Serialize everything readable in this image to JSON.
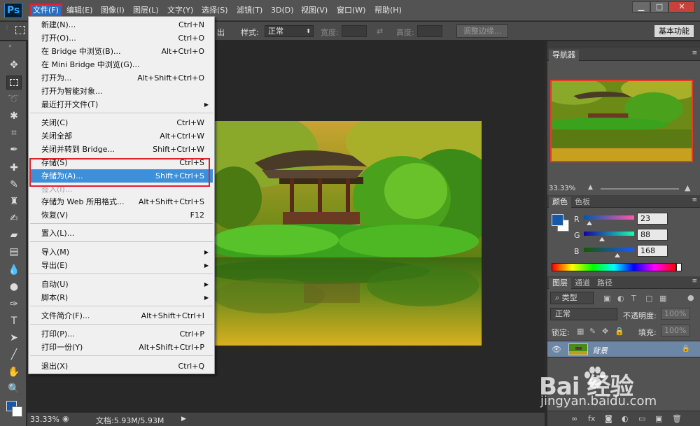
{
  "app": {
    "logo": "Ps"
  },
  "menubar": {
    "items": [
      "文件(F)",
      "编辑(E)",
      "图像(I)",
      "图层(L)",
      "文字(Y)",
      "选择(S)",
      "滤镜(T)",
      "3D(D)",
      "视图(V)",
      "窗口(W)",
      "帮助(H)"
    ],
    "active_index": 0
  },
  "window_controls": {
    "minimize": "▁",
    "maximize": "□",
    "close": "✕"
  },
  "options_bar": {
    "feather_tail": "出",
    "style_label": "样式:",
    "style_value": "正常",
    "width_label": "宽度:",
    "height_label": "高度:",
    "refine_edge_label": "调整边缘...",
    "workspace_label": "基本功能"
  },
  "file_menu": {
    "items": [
      {
        "label": "新建(N)...",
        "shortcut": "Ctrl+N"
      },
      {
        "label": "打开(O)...",
        "shortcut": "Ctrl+O"
      },
      {
        "label": "在 Bridge 中浏览(B)...",
        "shortcut": "Alt+Ctrl+O"
      },
      {
        "label": "在 Mini Bridge 中浏览(G)...",
        "shortcut": ""
      },
      {
        "label": "打开为...",
        "shortcut": "Alt+Shift+Ctrl+O"
      },
      {
        "label": "打开为智能对象...",
        "shortcut": ""
      },
      {
        "label": "最近打开文件(T)",
        "shortcut": "",
        "submenu": true
      },
      {
        "label": "关闭(C)",
        "shortcut": "Ctrl+W"
      },
      {
        "label": "关闭全部",
        "shortcut": "Alt+Ctrl+W"
      },
      {
        "label": "关闭并转到 Bridge...",
        "shortcut": "Shift+Ctrl+W"
      },
      {
        "label": "存储(S)",
        "shortcut": "Ctrl+S"
      },
      {
        "label": "存储为(A)...",
        "shortcut": "Shift+Ctrl+S",
        "highlight": true
      },
      {
        "label": "签入(I)...",
        "shortcut": "",
        "disabled": true
      },
      {
        "label": "存储为 Web 所用格式...",
        "shortcut": "Alt+Shift+Ctrl+S"
      },
      {
        "label": "恢复(V)",
        "shortcut": "F12"
      },
      {
        "label": "置入(L)...",
        "shortcut": ""
      },
      {
        "label": "导入(M)",
        "shortcut": "",
        "submenu": true
      },
      {
        "label": "导出(E)",
        "shortcut": "",
        "submenu": true
      },
      {
        "label": "自动(U)",
        "shortcut": "",
        "submenu": true
      },
      {
        "label": "脚本(R)",
        "shortcut": "",
        "submenu": true
      },
      {
        "label": "文件简介(F)...",
        "shortcut": "Alt+Shift+Ctrl+I"
      },
      {
        "label": "打印(P)...",
        "shortcut": "Ctrl+P"
      },
      {
        "label": "打印一份(Y)",
        "shortcut": "Alt+Shift+Ctrl+P"
      },
      {
        "label": "退出(X)",
        "shortcut": "Ctrl+Q"
      }
    ]
  },
  "navigator": {
    "tab": "导航器",
    "zoom": "33.33%"
  },
  "color_panel": {
    "tabs": [
      "颜色",
      "色板"
    ],
    "r_label": "R",
    "g_label": "G",
    "b_label": "B",
    "r": "23",
    "g": "88",
    "b": "168",
    "foreground_color": "#1758a8"
  },
  "layers_panel": {
    "tabs": [
      "图层",
      "通道",
      "路径"
    ],
    "kind_label": "类型",
    "blend_mode": "正常",
    "opacity_label": "不透明度:",
    "opacity_value": "100%",
    "lock_label": "锁定:",
    "fill_label": "填充:",
    "fill_value": "100%",
    "layer_name": "背景"
  },
  "status_bar": {
    "zoom": "33.33%",
    "doc_info": "文档:5.93M/5.93M"
  },
  "watermark": {
    "brand": "Bai  经验",
    "url": "jingyan.baidu.com"
  }
}
